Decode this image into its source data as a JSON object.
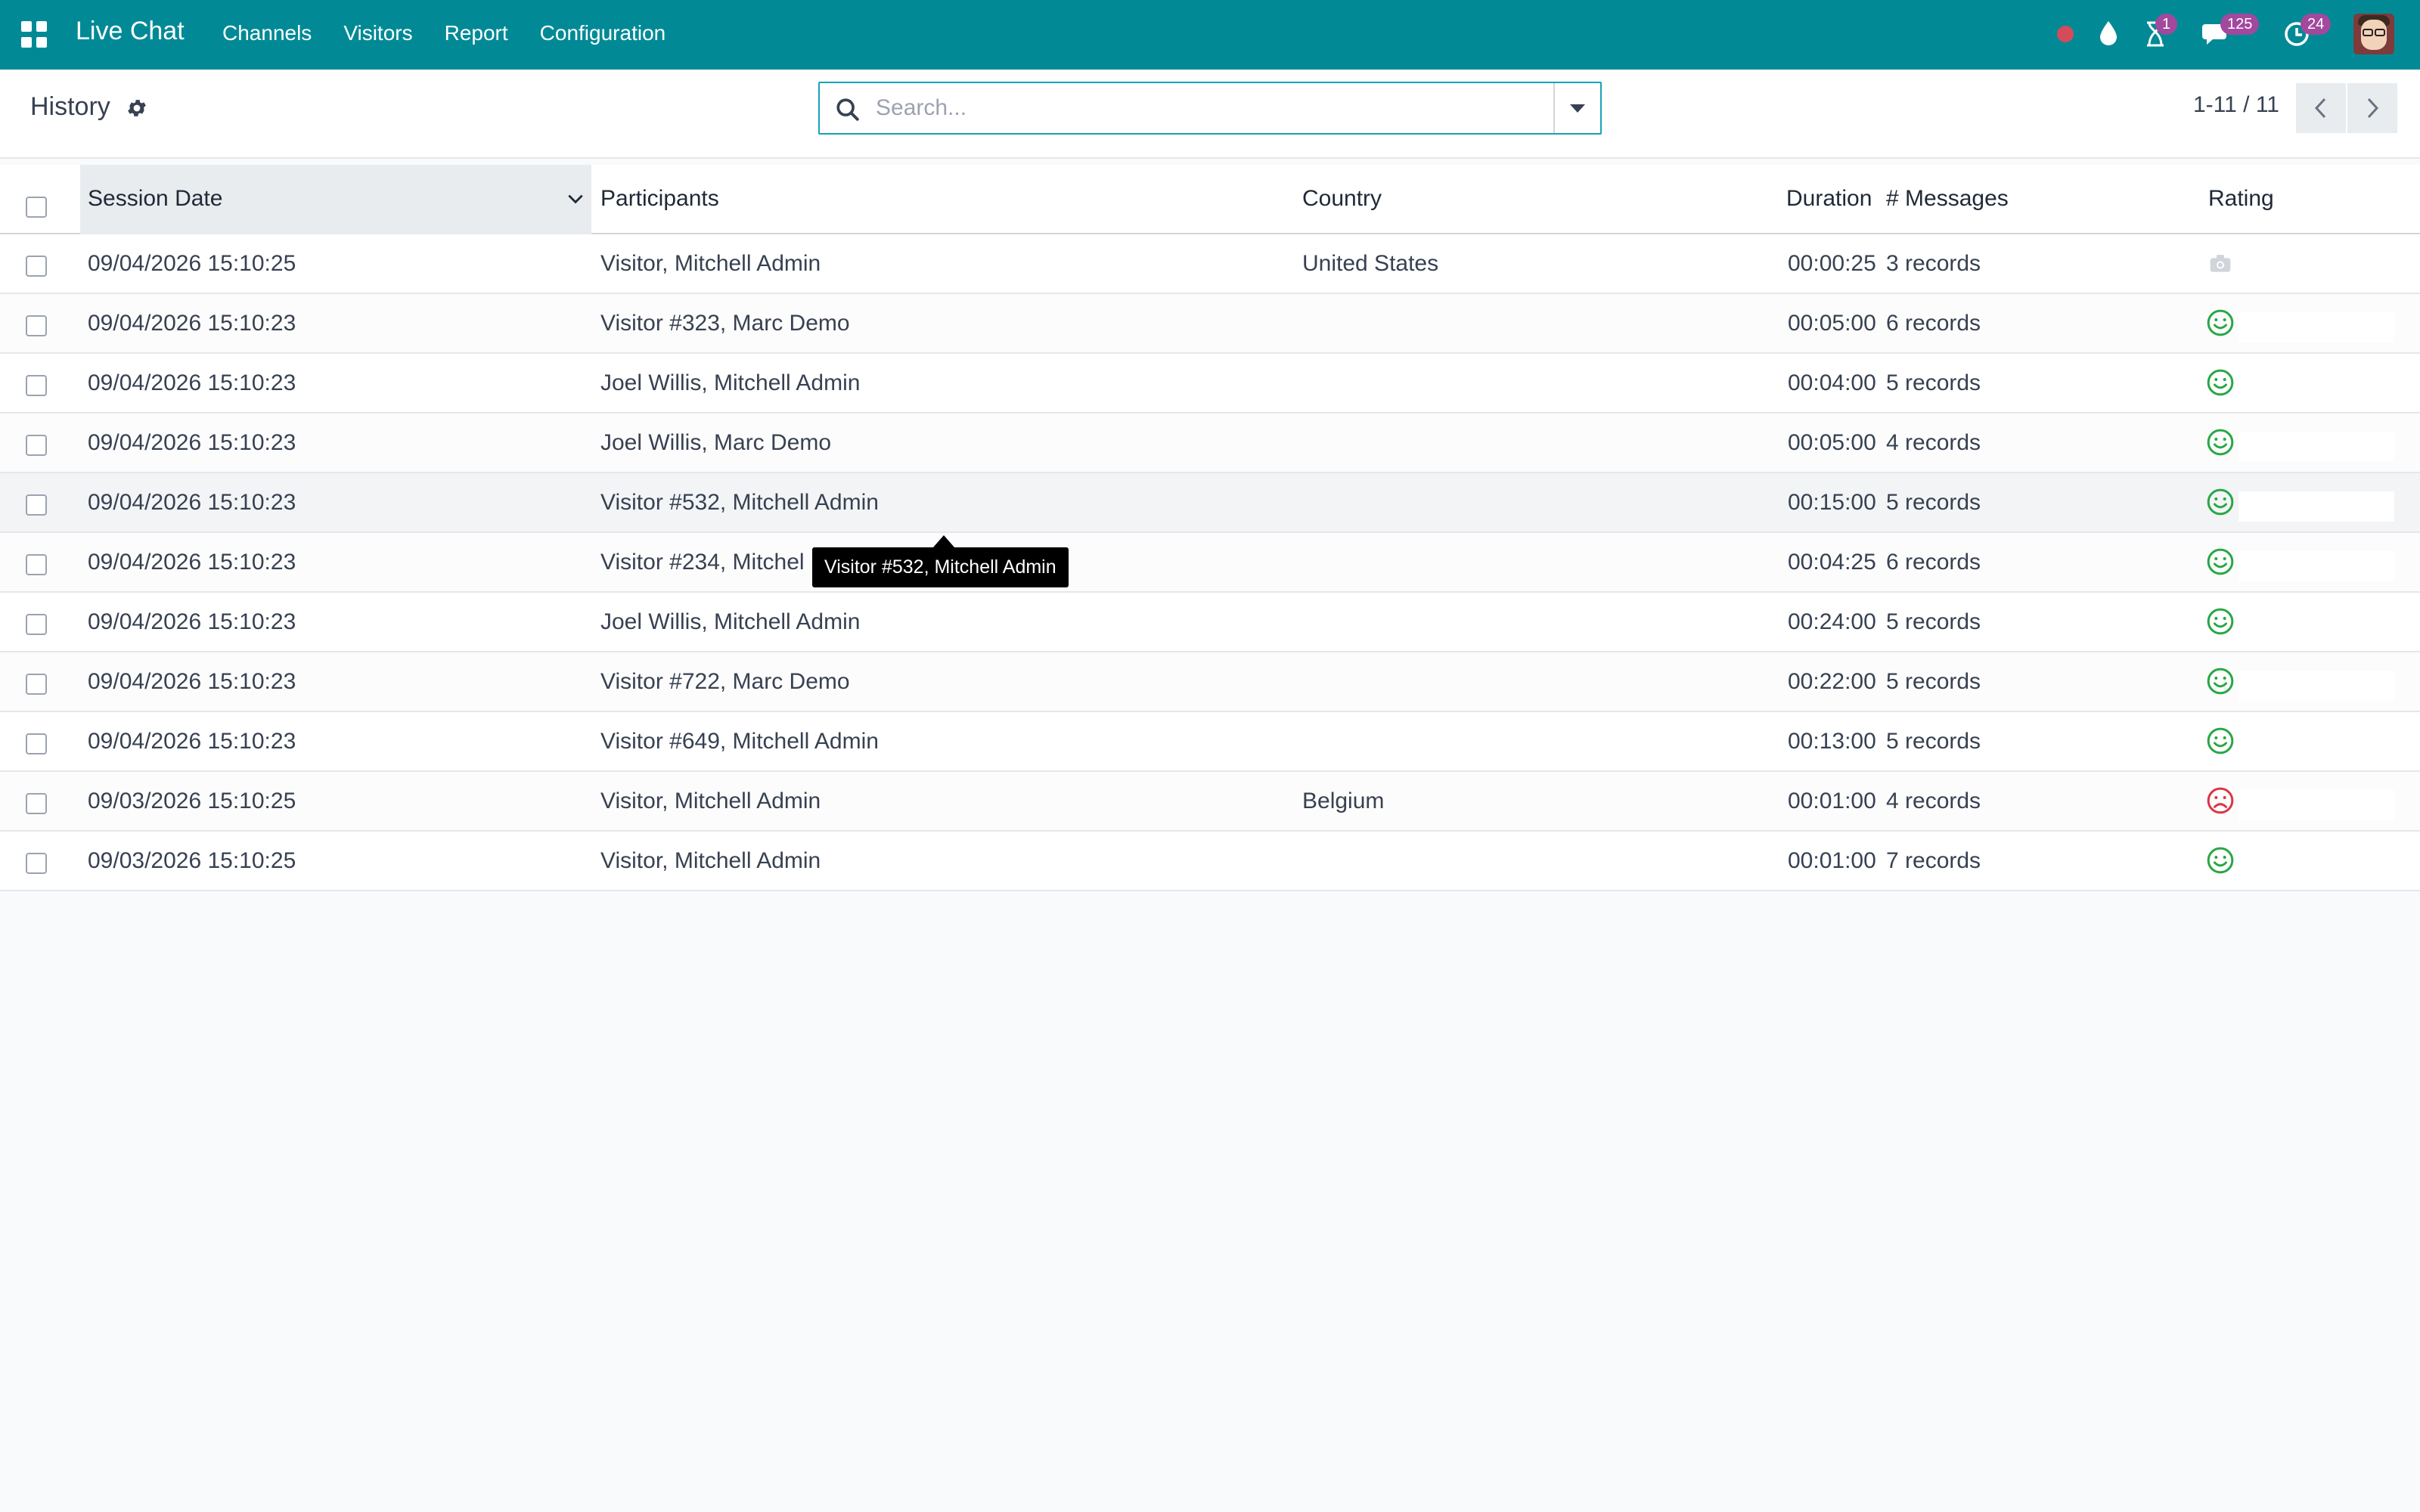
{
  "navbar": {
    "brand": "Live Chat",
    "menu": [
      "Channels",
      "Visitors",
      "Report",
      "Configuration"
    ],
    "badges": {
      "activity": "1",
      "messages": "125",
      "clock": "24"
    }
  },
  "control_panel": {
    "title": "History",
    "search_placeholder": "Search...",
    "pager": "1-11 / 11"
  },
  "table": {
    "headers": {
      "session_date": "Session Date",
      "participants": "Participants",
      "country": "Country",
      "duration": "Duration",
      "messages": "# Messages",
      "rating": "Rating"
    },
    "rows": [
      {
        "date": "09/04/2026 15:10:25",
        "participants": "Visitor, Mitchell Admin",
        "country": "United States",
        "duration": "00:00:25",
        "messages": "3 records",
        "rating": "none"
      },
      {
        "date": "09/04/2026 15:10:23",
        "participants": "Visitor #323, Marc Demo",
        "country": "",
        "duration": "00:05:00",
        "messages": "6 records",
        "rating": "happy"
      },
      {
        "date": "09/04/2026 15:10:23",
        "participants": "Joel Willis, Mitchell Admin",
        "country": "",
        "duration": "00:04:00",
        "messages": "5 records",
        "rating": "happy"
      },
      {
        "date": "09/04/2026 15:10:23",
        "participants": "Joel Willis, Marc Demo",
        "country": "",
        "duration": "00:05:00",
        "messages": "4 records",
        "rating": "happy"
      },
      {
        "date": "09/04/2026 15:10:23",
        "participants": "Visitor #532, Mitchell Admin",
        "country": "",
        "duration": "00:15:00",
        "messages": "5 records",
        "rating": "happy"
      },
      {
        "date": "09/04/2026 15:10:23",
        "participants": "Visitor #234, Mitchel",
        "country": "",
        "duration": "00:04:25",
        "messages": "6 records",
        "rating": "happy"
      },
      {
        "date": "09/04/2026 15:10:23",
        "participants": "Joel Willis, Mitchell Admin",
        "country": "",
        "duration": "00:24:00",
        "messages": "5 records",
        "rating": "happy"
      },
      {
        "date": "09/04/2026 15:10:23",
        "participants": "Visitor #722, Marc Demo",
        "country": "",
        "duration": "00:22:00",
        "messages": "5 records",
        "rating": "happy"
      },
      {
        "date": "09/04/2026 15:10:23",
        "participants": "Visitor #649, Mitchell Admin",
        "country": "",
        "duration": "00:13:00",
        "messages": "5 records",
        "rating": "happy"
      },
      {
        "date": "09/03/2026 15:10:25",
        "participants": "Visitor, Mitchell Admin",
        "country": "Belgium",
        "duration": "00:01:00",
        "messages": "4 records",
        "rating": "unhappy"
      },
      {
        "date": "09/03/2026 15:10:25",
        "participants": "Visitor, Mitchell Admin",
        "country": "",
        "duration": "00:01:00",
        "messages": "7 records",
        "rating": "happy"
      }
    ]
  },
  "tooltip": "Visitor #532, Mitchell Admin",
  "colors": {
    "navbar": "#018a96",
    "happy": "#28a745",
    "unhappy": "#dc3545",
    "badge": "#a2489d"
  }
}
